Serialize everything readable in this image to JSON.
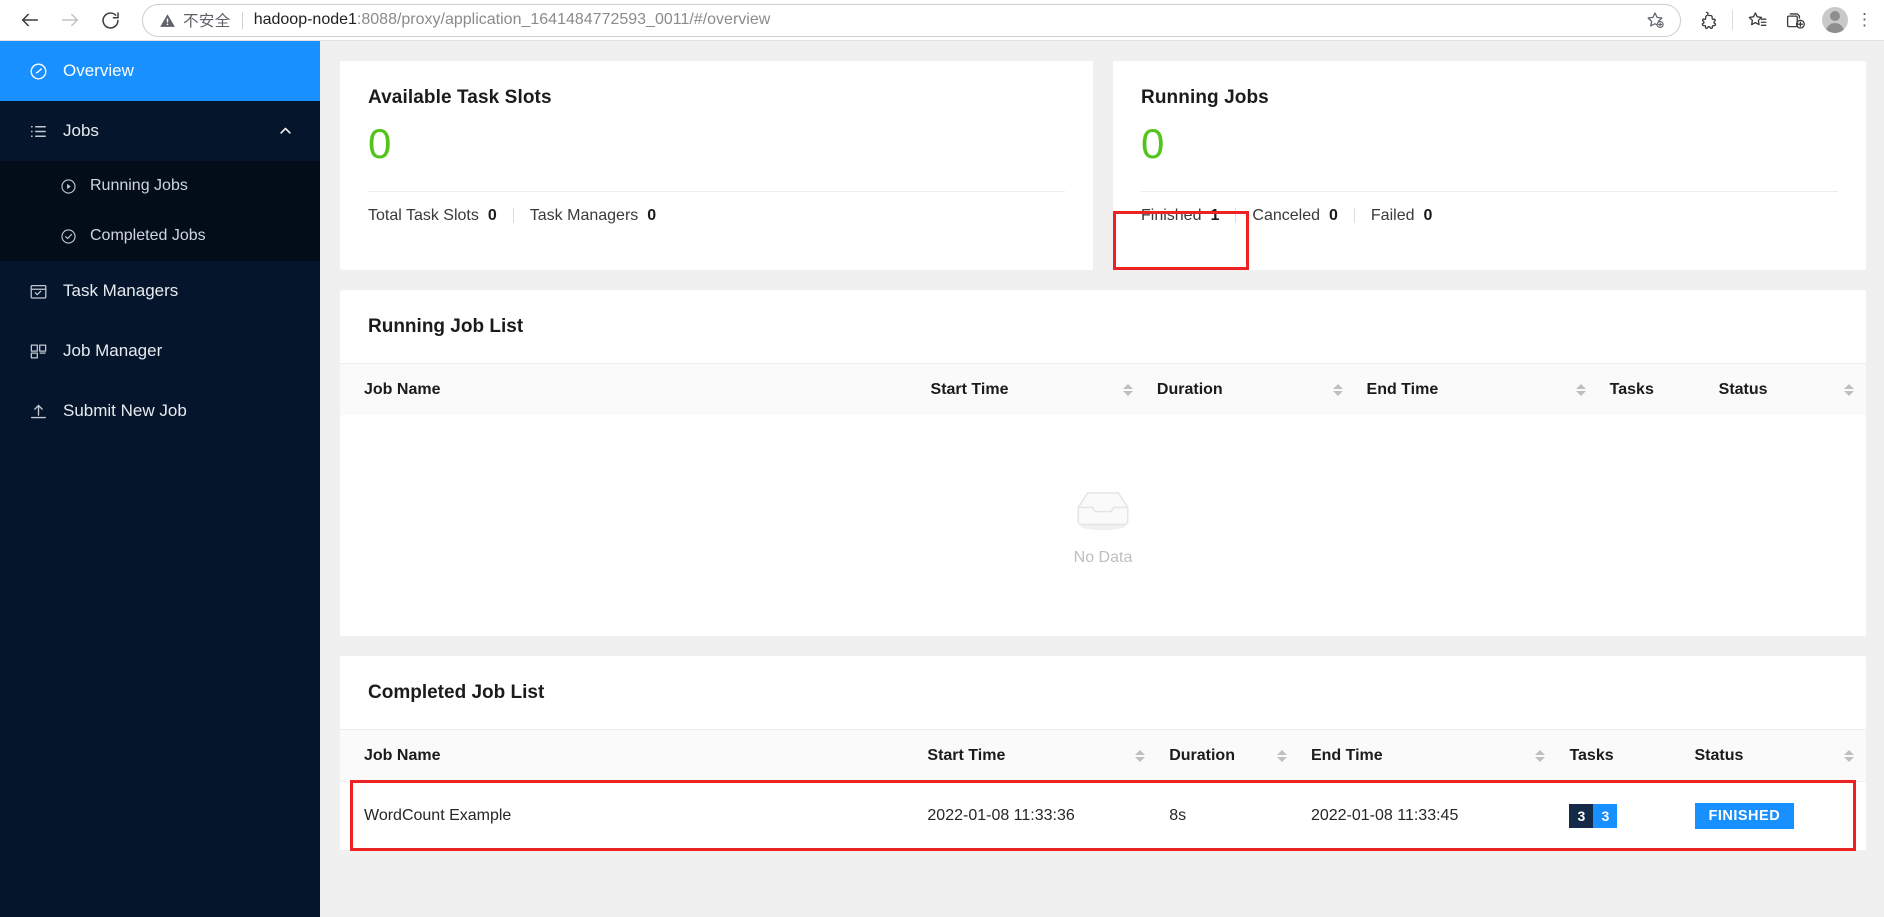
{
  "browser": {
    "back_label": "Back",
    "forward_label": "Forward",
    "reload_label": "Reload",
    "security_label": "不安全",
    "url_host": "hadoop-node1",
    "url_rest": ":8088/proxy/application_1641484772593_0011/#/overview",
    "url_full": "hadoop-node1:8088/proxy/application_1641484772593_0011/#/overview",
    "favorite_label": "Add this page to favorites",
    "extensions_label": "Extensions",
    "favorites_label": "Favorites",
    "collections_label": "Collections",
    "profile_label": "Profile",
    "settings_label": "Settings and more"
  },
  "sidebar": {
    "items": [
      {
        "label": "Overview",
        "icon": "dashboard-icon",
        "active": true
      },
      {
        "label": "Jobs",
        "icon": "list-icon",
        "active": false,
        "expanded": true,
        "children": [
          {
            "label": "Running Jobs",
            "icon": "play-circle-icon"
          },
          {
            "label": "Completed Jobs",
            "icon": "check-circle-icon"
          }
        ]
      },
      {
        "label": "Task Managers",
        "icon": "calendar-check-icon",
        "active": false
      },
      {
        "label": "Job Manager",
        "icon": "cluster-icon",
        "active": false
      },
      {
        "label": "Submit New Job",
        "icon": "upload-icon",
        "active": false
      }
    ]
  },
  "cards": {
    "task_slots": {
      "title": "Available Task Slots",
      "value": "0",
      "value_color": "#52c41a",
      "footer": [
        {
          "label": "Total Task Slots",
          "value": "0"
        },
        {
          "label": "Task Managers",
          "value": "0"
        }
      ]
    },
    "running_jobs": {
      "title": "Running Jobs",
      "value": "0",
      "value_color": "#52c41a",
      "footer": [
        {
          "label": "Finished",
          "value": "1",
          "highlighted": true
        },
        {
          "label": "Canceled",
          "value": "0"
        },
        {
          "label": "Failed",
          "value": "0"
        }
      ]
    }
  },
  "running_list": {
    "title": "Running Job List",
    "columns": [
      "Job Name",
      "Start Time",
      "Duration",
      "End Time",
      "Tasks",
      "Status"
    ],
    "rows": [],
    "empty_text": "No Data"
  },
  "completed_list": {
    "title": "Completed Job List",
    "columns": [
      "Job Name",
      "Start Time",
      "Duration",
      "End Time",
      "Tasks",
      "Status"
    ],
    "rows": [
      {
        "job_name": "WordCount Example",
        "start_time": "2022-01-08 11:33:36",
        "duration": "8s",
        "end_time": "2022-01-08 11:33:45",
        "tasks_total": "3",
        "tasks_finished": "3",
        "status": "FINISHED",
        "highlighted": true
      }
    ]
  },
  "colors": {
    "accent": "#1890ff",
    "success": "#52c41a",
    "sidebar_bg": "#05152b",
    "submenu_bg": "#030d1a",
    "highlight": "#ee2222",
    "badge_dark": "#142a47"
  }
}
